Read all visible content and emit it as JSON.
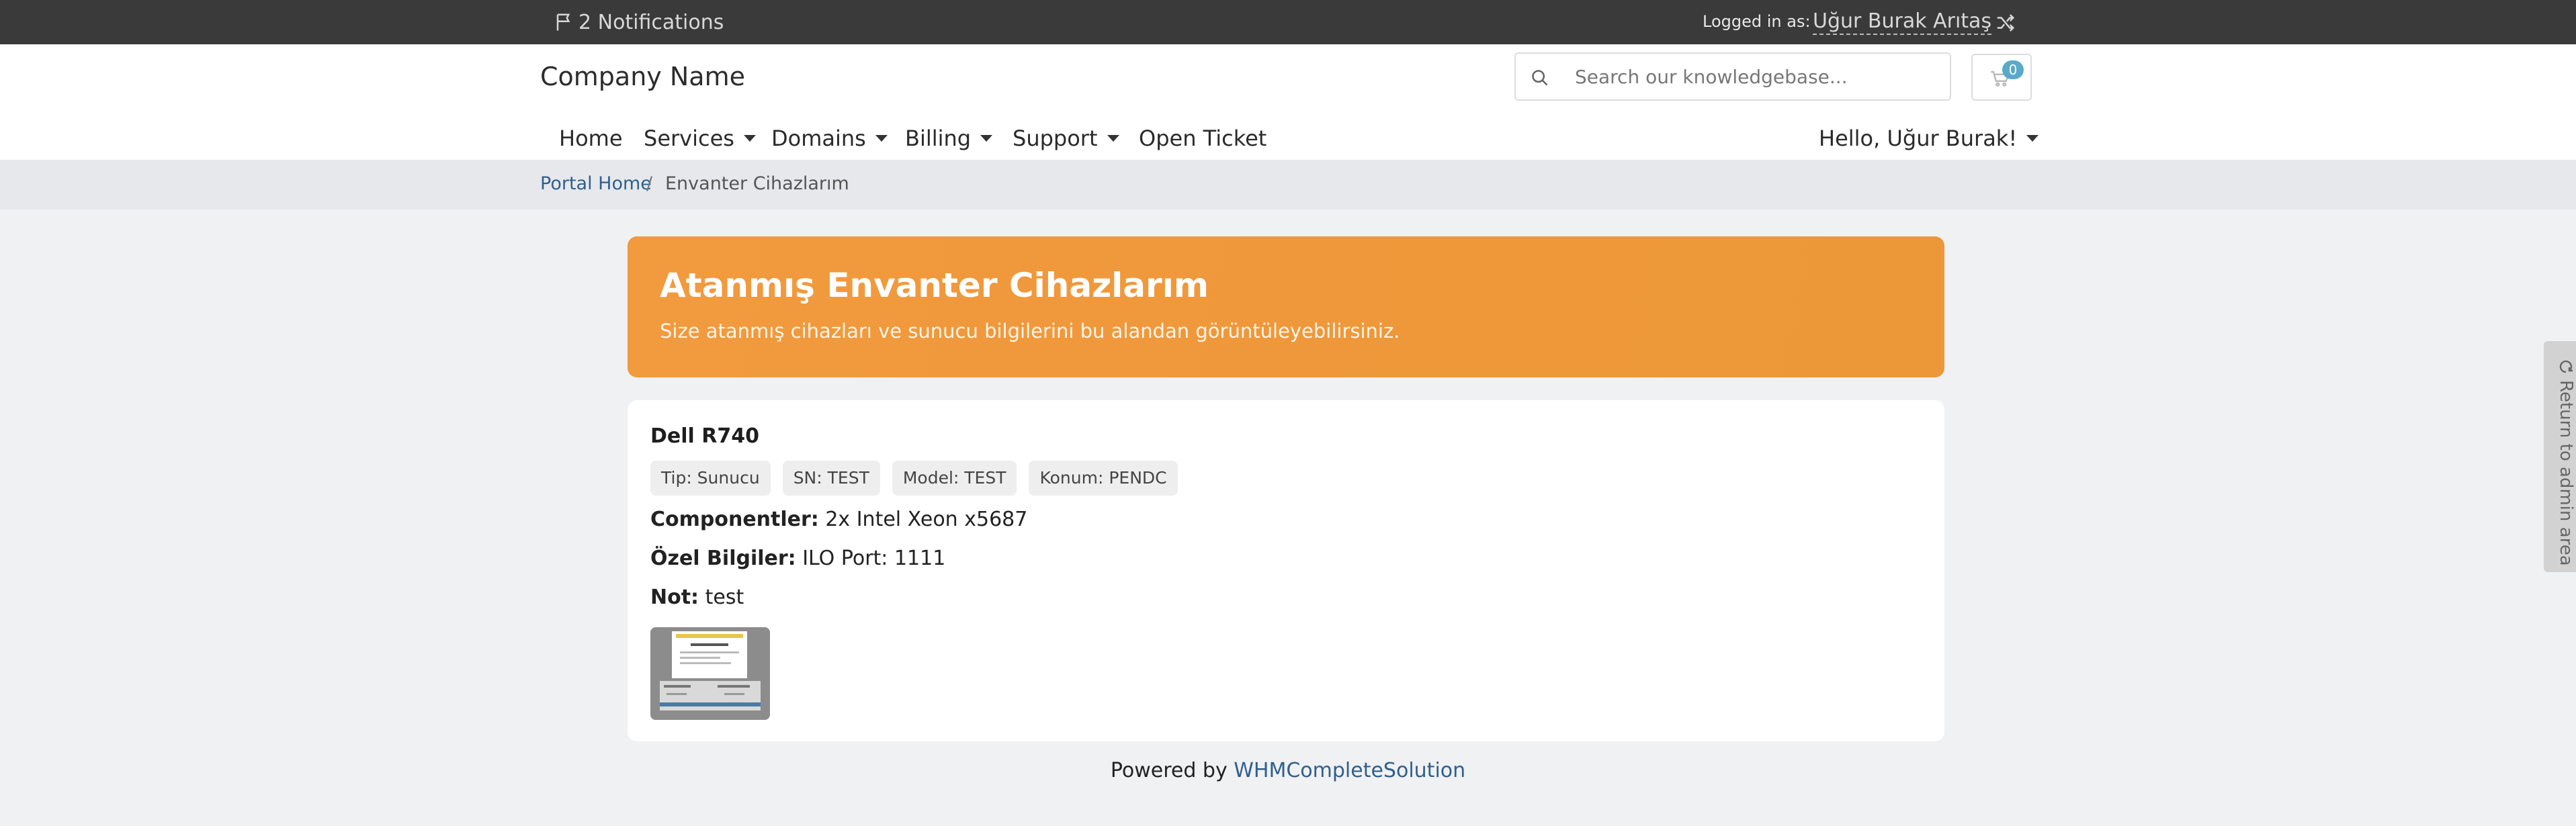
{
  "topbar": {
    "notifications_label": "2 Notifications",
    "logged_in_label": "Logged in as:",
    "user_name": "Uğur Burak Arıtaş",
    "notification_icon": "flag-icon",
    "switch_icon": "shuffle-icon"
  },
  "header": {
    "brand": "Company Name",
    "search_placeholder": "Search our knowledgebase...",
    "cart_count": "0"
  },
  "nav": {
    "home": "Home",
    "services": "Services",
    "domains": "Domains",
    "billing": "Billing",
    "support": "Support",
    "open_ticket": "Open Ticket",
    "account": "Hello, Uğur Burak!"
  },
  "breadcrumb": {
    "home": "Portal Home",
    "separator": "/",
    "current": "Envanter Cihazlarım"
  },
  "hero": {
    "title": "Atanmış Envanter Cihazlarım",
    "subtitle": "Size atanmış cihazları ve sunucu bilgilerini bu alandan görüntüleyebilirsiniz."
  },
  "device": {
    "name": "Dell R740",
    "chips": {
      "type": "Tip: Sunucu",
      "serial": "SN: TEST",
      "model": "Model: TEST",
      "location": "Konum: PENDC"
    },
    "components_label": "Componentler:",
    "components_value": " 2x Intel Xeon x5687",
    "special_label": "Özel Bilgiler:",
    "special_value": " ILO Port: 1111",
    "note_label": "Not:",
    "note_value": " test"
  },
  "footer": {
    "powered_by": "Powered by ",
    "link": "WHMCompleteSolution"
  },
  "admin_tab": {
    "label": "Return to admin area"
  },
  "colors": {
    "topbar_bg": "#3a3a3a",
    "hero_orange": "#f29a3e",
    "link_blue": "#2f5f8f",
    "badge_blue": "#5aa9c8",
    "page_bg": "#f0f1f2"
  }
}
